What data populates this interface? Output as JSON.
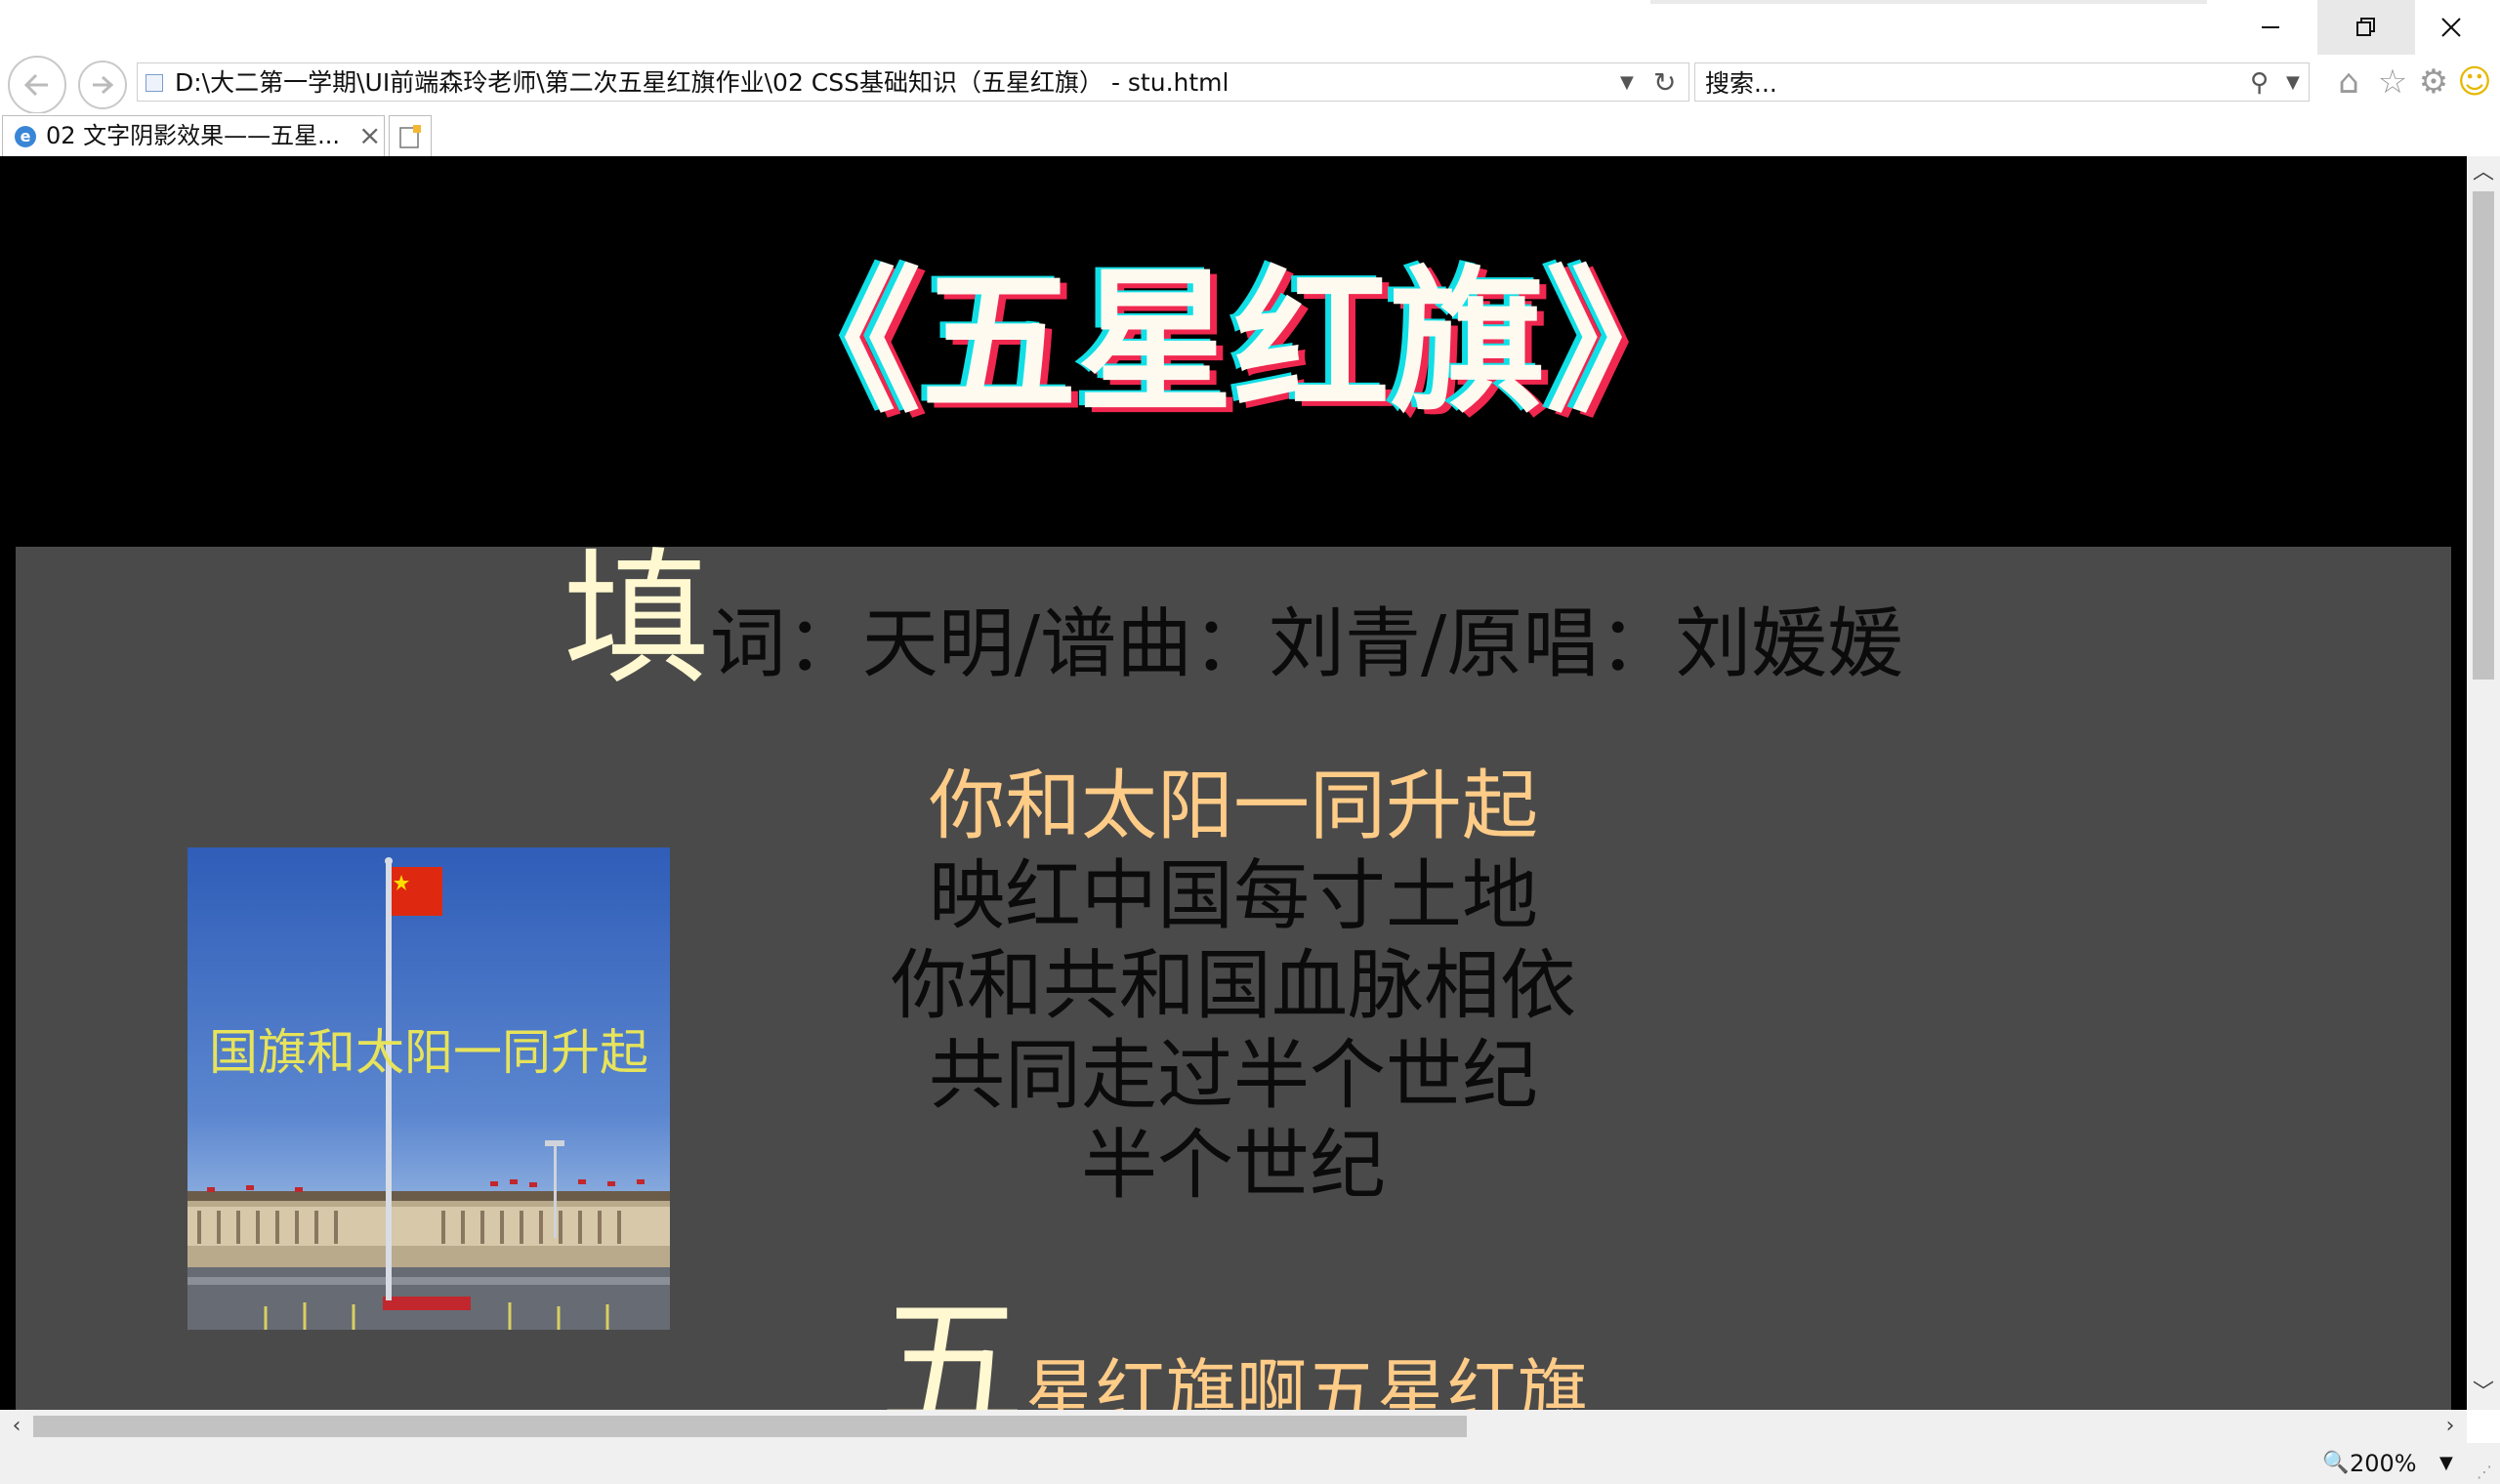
{
  "browser": {
    "window_controls": {
      "minimize": "minimize",
      "restore": "restore",
      "close": "close"
    },
    "address": "D:\\大二第一学期\\UI前端森玲老师\\第二次五星红旗作业\\02 CSS基础知识（五星红旗） - stu.html",
    "search_placeholder": "搜索...",
    "tab": {
      "title": "02 文字阴影效果——五星...",
      "close": "×"
    },
    "zoom": "200%"
  },
  "page": {
    "title": "《五星红旗》",
    "credits": {
      "first_char": "填",
      "rest": "词：天明/谱曲：刘青/原唱：刘媛媛"
    },
    "photo_caption": "国旗和太阳一同升起",
    "verse": [
      "你和太阳一同升起",
      "映红中国每寸土地",
      "你和共和国血脉相依",
      "共同走过半个世纪",
      "半个世纪"
    ],
    "chorus": {
      "first_char": "五",
      "rest": "星红旗啊五星红旗"
    }
  },
  "colors": {
    "page_bg": "#000000",
    "content_bg": "#4a4a4a",
    "title_shadow_cyan": "#10dfe6",
    "title_shadow_red": "#f0274f",
    "gold_text": "#ffcc88",
    "caption_yellow": "#e7e35a",
    "flag_red": "#de2910"
  }
}
